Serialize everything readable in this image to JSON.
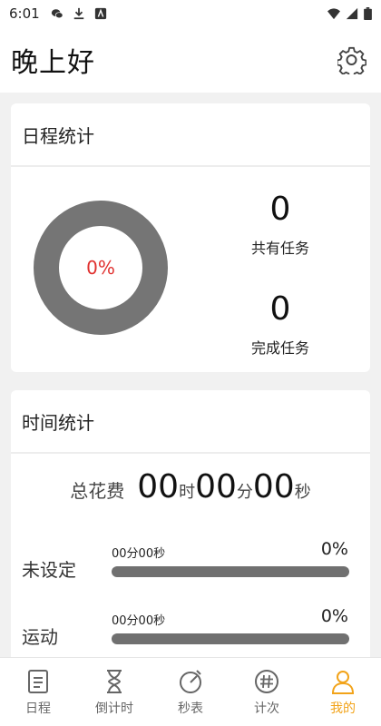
{
  "status_bar": {
    "time": "6:01"
  },
  "header": {
    "greeting": "晚上好"
  },
  "schedule_stats": {
    "title": "日程统计",
    "percent": "0%",
    "total_tasks": "0",
    "total_label": "共有任务",
    "done_tasks": "0",
    "done_label": "完成任务"
  },
  "time_stats": {
    "title": "时间统计",
    "total_label": "总花费",
    "hours": "00",
    "hours_unit": "时",
    "minutes": "00",
    "minutes_unit": "分",
    "seconds": "00",
    "seconds_unit": "秒",
    "categories": [
      {
        "name": "未设定",
        "time": "00分00秒",
        "percent": "0%",
        "fraction": 0
      },
      {
        "name": "运动",
        "time": "00分00秒",
        "percent": "0%",
        "fraction": 0
      }
    ]
  },
  "tabs": [
    {
      "label": "日程",
      "icon": "schedule-list-icon"
    },
    {
      "label": "倒计时",
      "icon": "hourglass-icon"
    },
    {
      "label": "秒表",
      "icon": "stopwatch-icon"
    },
    {
      "label": "计次",
      "icon": "hash-count-icon"
    },
    {
      "label": "我的",
      "icon": "user-profile-icon",
      "active": true
    }
  ],
  "colors": {
    "accent": "#f2a319",
    "donut": "#757575",
    "percent_text": "#e0302e",
    "bar_track": "#707070"
  }
}
